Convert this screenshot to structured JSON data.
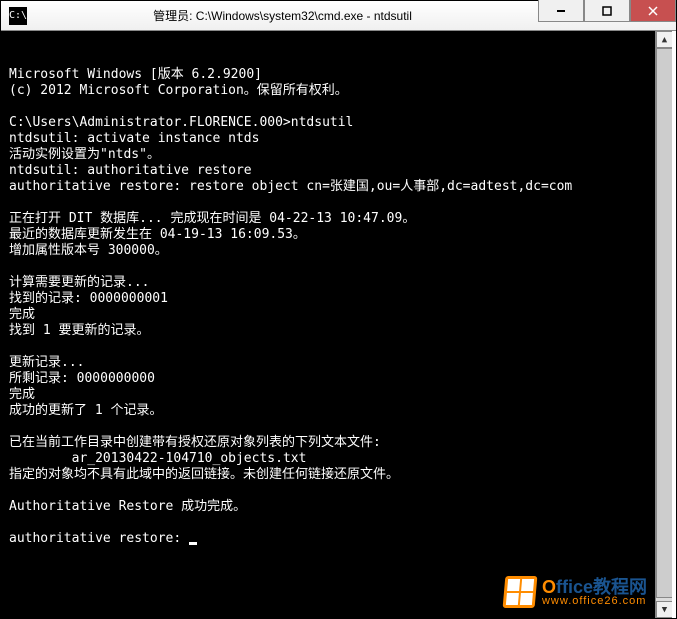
{
  "window": {
    "title": "管理员: C:\\Windows\\system32\\cmd.exe - ntdsutil",
    "icon_label": "C:\\"
  },
  "terminal": {
    "lines": [
      "Microsoft Windows [版本 6.2.9200]",
      "(c) 2012 Microsoft Corporation。保留所有权利。",
      "",
      "C:\\Users\\Administrator.FLORENCE.000>ntdsutil",
      "ntdsutil: activate instance ntds",
      "活动实例设置为\"ntds\"。",
      "ntdsutil: authoritative restore",
      "authoritative restore: restore object cn=张建国,ou=人事部,dc=adtest,dc=com",
      "",
      "正在打开 DIT 数据库... 完成现在时间是 04-22-13 10:47.09。",
      "最近的数据库更新发生在 04-19-13 16:09.53。",
      "增加属性版本号 300000。",
      "",
      "计算需要更新的记录...",
      "找到的记录: 0000000001",
      "完成",
      "找到 1 要更新的记录。",
      "",
      "更新记录...",
      "所剩记录: 0000000000",
      "完成",
      "成功的更新了 1 个记录。",
      "",
      "已在当前工作目录中创建带有授权还原对象列表的下列文本文件:",
      "        ar_20130422-104710_objects.txt",
      "指定的对象均不具有此域中的返回链接。未创建任何链接还原文件。",
      "",
      "Authoritative Restore 成功完成。",
      "",
      "authoritative restore: "
    ]
  },
  "watermark": {
    "brand_prefix": "O",
    "brand_suffix": "ffice教程网",
    "url": "www.office26.com"
  }
}
